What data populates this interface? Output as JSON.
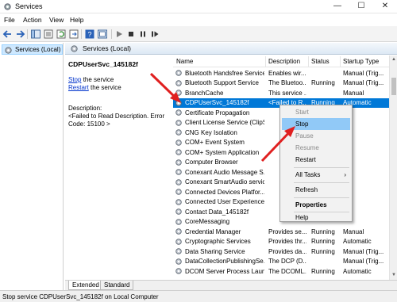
{
  "window": {
    "title": "Services",
    "minimize_glyph": "—",
    "maximize_glyph": "☐",
    "close_glyph": "✕"
  },
  "menu": [
    "File",
    "Action",
    "View",
    "Help"
  ],
  "tree": {
    "root_label": "Services (Local)"
  },
  "header": {
    "label": "Services (Local)"
  },
  "details": {
    "service_name": "CDPUserSvc_145182f",
    "stop_link": "Stop",
    "stop_suffix": " the service",
    "restart_link": "Restart",
    "restart_suffix": " the service",
    "description_label": "Description:",
    "description_text": "<Failed to Read Description. Error Code: 15100 >"
  },
  "columns": {
    "name": "Name",
    "description": "Description",
    "status": "Status",
    "startup": "Startup Type"
  },
  "services": [
    {
      "name": "Bluetooth Handsfree Service",
      "description": "Enables wir...",
      "status": "",
      "startup": "Manual (Trig..."
    },
    {
      "name": "Bluetooth Support Service",
      "description": "The Bluetoo...",
      "status": "Running",
      "startup": "Manual (Trig..."
    },
    {
      "name": "BranchCache",
      "description": "This service ...",
      "status": "",
      "startup": "Manual"
    },
    {
      "name": "CDPUserSvc_145182f",
      "description": "<Failed to R...",
      "status": "Running",
      "startup": "Automatic"
    },
    {
      "name": "Certificate Propagation",
      "description": "",
      "status": "",
      "startup": ""
    },
    {
      "name": "Client License Service (ClipS...",
      "description": "",
      "status": "",
      "startup": ""
    },
    {
      "name": "CNG Key Isolation",
      "description": "",
      "status": "",
      "startup": ""
    },
    {
      "name": "COM+ Event System",
      "description": "",
      "status": "",
      "startup": ""
    },
    {
      "name": "COM+ System Application",
      "description": "",
      "status": "",
      "startup": ""
    },
    {
      "name": "Computer Browser",
      "description": "",
      "status": "",
      "startup": ""
    },
    {
      "name": "Conexant Audio Message S...",
      "description": "",
      "status": "",
      "startup": ""
    },
    {
      "name": "Conexant SmartAudio service",
      "description": "",
      "status": "",
      "startup": ""
    },
    {
      "name": "Connected Devices Platfor...",
      "description": "",
      "status": "",
      "startup": ""
    },
    {
      "name": "Connected User Experience...",
      "description": "",
      "status": "",
      "startup": ""
    },
    {
      "name": "Contact Data_145182f",
      "description": "",
      "status": "",
      "startup": ""
    },
    {
      "name": "CoreMessaging",
      "description": "",
      "status": "",
      "startup": ""
    },
    {
      "name": "Credential Manager",
      "description": "Provides se...",
      "status": "Running",
      "startup": "Manual"
    },
    {
      "name": "Cryptographic Services",
      "description": "Provides thr...",
      "status": "Running",
      "startup": "Automatic"
    },
    {
      "name": "Data Sharing Service",
      "description": "Provides da...",
      "status": "Running",
      "startup": "Manual (Trig..."
    },
    {
      "name": "DataCollectionPublishingSe...",
      "description": "The DCP (D...",
      "status": "",
      "startup": "Manual (Trig..."
    },
    {
      "name": "DCOM Server Process Laun...",
      "description": "The DCOML...",
      "status": "Running",
      "startup": "Automatic"
    }
  ],
  "selected_index": 3,
  "context_menu": [
    {
      "label": "Start",
      "state": "disabled"
    },
    {
      "label": "Stop",
      "state": "hover"
    },
    {
      "label": "Pause",
      "state": "disabled"
    },
    {
      "label": "Resume",
      "state": "disabled"
    },
    {
      "label": "Restart",
      "state": "normal"
    },
    {
      "label": "All Tasks",
      "state": "submenu",
      "glyph": "›"
    },
    {
      "label": "Refresh",
      "state": "normal"
    },
    {
      "label": "Properties",
      "state": "bold"
    },
    {
      "label": "Help",
      "state": "normal"
    }
  ],
  "tabs": [
    "Extended",
    "Standard"
  ],
  "active_tab": "Extended",
  "status_text": "Stop service CDPUserSvc_145182f on Local Computer",
  "colors": {
    "selection": "#0078d7",
    "menu_hover": "#91c9f7",
    "annotation_arrow": "#e02020"
  }
}
